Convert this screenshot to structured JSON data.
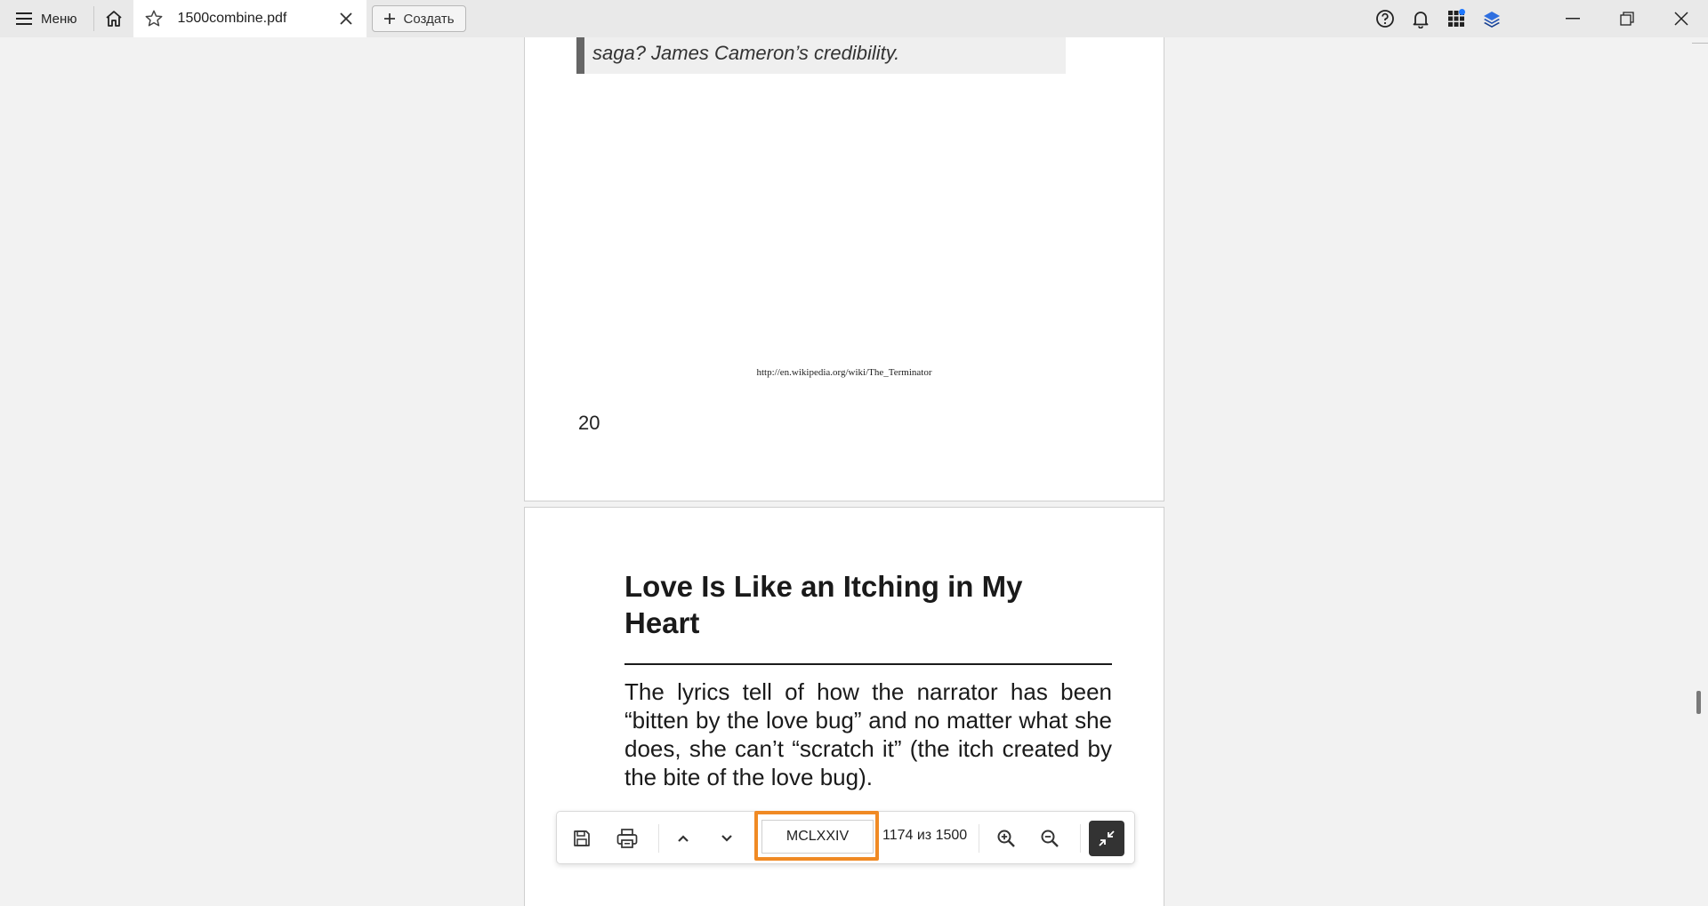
{
  "topbar": {
    "menu_label": "Меню",
    "tab_title": "1500combine.pdf",
    "new_label": "Создать"
  },
  "document": {
    "quote_text": "saga? James Cameron’s credibility.",
    "footnote_url": "http://en.wikipedia.org/wiki/The_Terminator",
    "page_number": "20",
    "article_title": "Love Is Like an Itching in My Heart",
    "article_body": "The lyrics tell of how the narrator has been “bitten by the love bug” and no matter what she does, she can’t “scratch it” (the itch created by the bite of the love bug)."
  },
  "toolbar": {
    "page_input_value": "MCLXXIV",
    "page_count": "1174 из 1500"
  },
  "colors": {
    "accent_highlight": "#f08a24",
    "notification_dot": "#1e78ff"
  },
  "icons": [
    "hamburger-icon",
    "home-icon",
    "star-icon",
    "close-icon",
    "plus-icon",
    "help-icon",
    "bell-icon",
    "apps-grid-icon",
    "layers-icon",
    "minimize-icon",
    "restore-icon",
    "save-icon",
    "print-icon",
    "chevron-up-icon",
    "chevron-down-icon",
    "zoom-in-icon",
    "zoom-out-icon",
    "collapse-icon"
  ]
}
